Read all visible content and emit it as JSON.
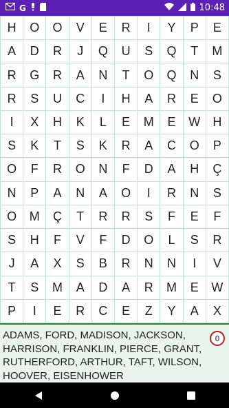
{
  "statusbar": {
    "time": "10:48",
    "icons": [
      "gmail-icon",
      "google-icon",
      "microphone-icon",
      "sd-card-icon",
      "wifi-icon",
      "signal-icon",
      "battery-icon"
    ]
  },
  "grid": {
    "rows": [
      [
        "H",
        "O",
        "O",
        "V",
        "E",
        "R",
        "I",
        "Y",
        "P",
        "E"
      ],
      [
        "A",
        "D",
        "R",
        "J",
        "Q",
        "U",
        "S",
        "Q",
        "T",
        "M"
      ],
      [
        "R",
        "G",
        "R",
        "A",
        "N",
        "T",
        "O",
        "Q",
        "N",
        "S"
      ],
      [
        "R",
        "S",
        "U",
        "C",
        "I",
        "H",
        "A",
        "R",
        "E",
        "O"
      ],
      [
        "I",
        "X",
        "H",
        "K",
        "L",
        "E",
        "M",
        "E",
        "W",
        "H"
      ],
      [
        "S",
        "K",
        "T",
        "S",
        "K",
        "R",
        "A",
        "C",
        "O",
        "P"
      ],
      [
        "O",
        "F",
        "R",
        "O",
        "N",
        "F",
        "D",
        "A",
        "H",
        "Ç"
      ],
      [
        "N",
        "P",
        "A",
        "N",
        "A",
        "O",
        "I",
        "R",
        "N",
        "S"
      ],
      [
        "O",
        "M",
        "Ç",
        "T",
        "R",
        "R",
        "S",
        "F",
        "E",
        "F"
      ],
      [
        "S",
        "H",
        "F",
        "V",
        "F",
        "D",
        "O",
        "L",
        "S",
        "R"
      ],
      [
        "J",
        "A",
        "X",
        "S",
        "B",
        "R",
        "N",
        "N",
        "I",
        "V"
      ],
      [
        "T",
        "S",
        "M",
        "A",
        "D",
        "A",
        "R",
        "M",
        "E",
        "W"
      ],
      [
        "P",
        "I",
        "E",
        "R",
        "C",
        "E",
        "Z",
        "Y",
        "A",
        "X"
      ]
    ]
  },
  "wordlist": {
    "text": "ADAMS, FORD, MADISON, JACKSON, HARRISON, FRANKLIN, PIERCE, GRANT, RUTHERFORD, ARTHUR, TAFT, WILSON, HOOVER, EISENHOWER",
    "found_count": "0"
  },
  "colors": {
    "statusbar": "#5b21b6",
    "grid_line": "#bfe3d5",
    "wordlist_bg": "#e9f4ef",
    "counter_border": "#b71c1c"
  }
}
